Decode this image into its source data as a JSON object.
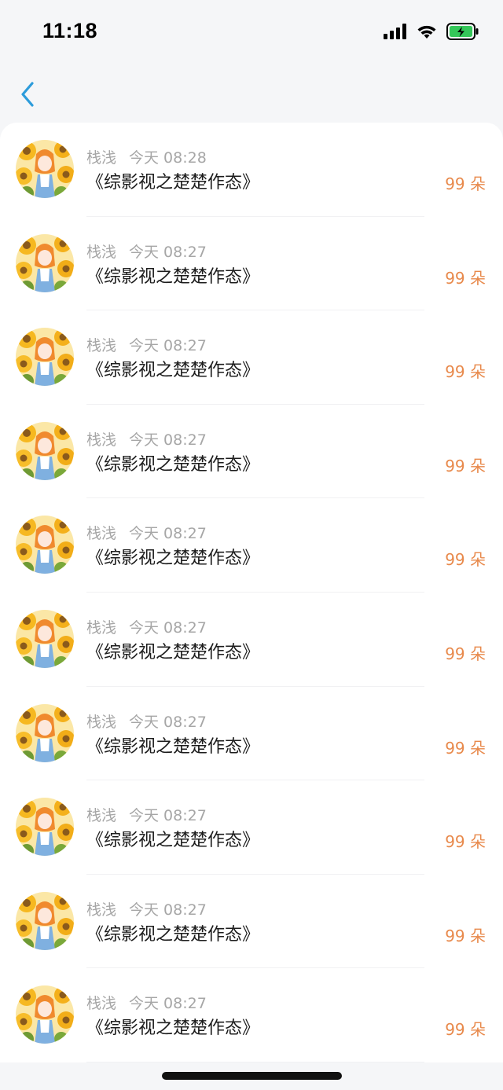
{
  "status_bar": {
    "time": "11:18",
    "signal_icon": "signal-bars-icon",
    "wifi_icon": "wifi-icon",
    "battery_icon": "battery-charging-icon",
    "battery_color": "#34c759"
  },
  "nav": {
    "back_icon": "chevron-left-icon",
    "back_color": "#2d9cdb"
  },
  "items": [
    {
      "name": "栈浅",
      "time": "今天 08:28",
      "title": "《综影视之楚楚作态》",
      "count": "99 朵"
    },
    {
      "name": "栈浅",
      "time": "今天 08:27",
      "title": "《综影视之楚楚作态》",
      "count": "99 朵"
    },
    {
      "name": "栈浅",
      "time": "今天 08:27",
      "title": "《综影视之楚楚作态》",
      "count": "99 朵"
    },
    {
      "name": "栈浅",
      "time": "今天 08:27",
      "title": "《综影视之楚楚作态》",
      "count": "99 朵"
    },
    {
      "name": "栈浅",
      "time": "今天 08:27",
      "title": "《综影视之楚楚作态》",
      "count": "99 朵"
    },
    {
      "name": "栈浅",
      "time": "今天 08:27",
      "title": "《综影视之楚楚作态》",
      "count": "99 朵"
    },
    {
      "name": "栈浅",
      "time": "今天 08:27",
      "title": "《综影视之楚楚作态》",
      "count": "99 朵"
    },
    {
      "name": "栈浅",
      "time": "今天 08:27",
      "title": "《综影视之楚楚作态》",
      "count": "99 朵"
    },
    {
      "name": "栈浅",
      "time": "今天 08:27",
      "title": "《综影视之楚楚作态》",
      "count": "99 朵"
    },
    {
      "name": "栈浅",
      "time": "今天 08:27",
      "title": "《综影视之楚楚作态》",
      "count": "99 朵"
    }
  ],
  "colors": {
    "accent_count": "#e8894b",
    "meta_text": "#a6a6a6",
    "title_text": "#1c1c1c"
  }
}
